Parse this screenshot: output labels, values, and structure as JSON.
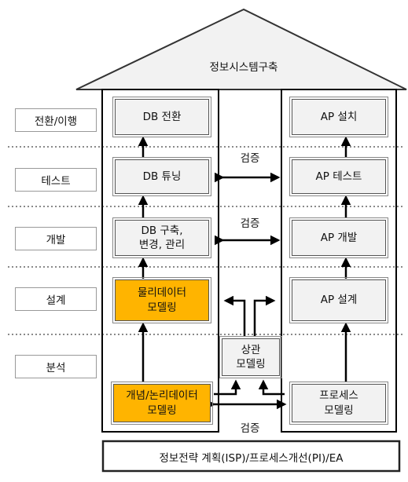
{
  "roof_title": "정보시스템구축",
  "stages": [
    "전환/이행",
    "테스트",
    "개발",
    "설계",
    "분석"
  ],
  "db_column": {
    "items": [
      "DB 전환",
      "DB 튜닝",
      "DB 구축,\n변경, 관리",
      "물리데이터\n모델링",
      "개념/논리데이터\n모델링"
    ]
  },
  "ap_column": {
    "items": [
      "AP 설치",
      "AP 테스트",
      "AP 개발",
      "AP 설계",
      "프로세스\n모델링"
    ]
  },
  "center": {
    "verify_labels": [
      "검증",
      "검증",
      "검증"
    ],
    "correlation_box": "상관\n모델링"
  },
  "foundation": "정보전략 계획(ISP)/프로세스개선(PI)/EA",
  "colors": {
    "highlight": "#ffb400",
    "box_fill": "#f2f2f2",
    "line": "#000000"
  }
}
